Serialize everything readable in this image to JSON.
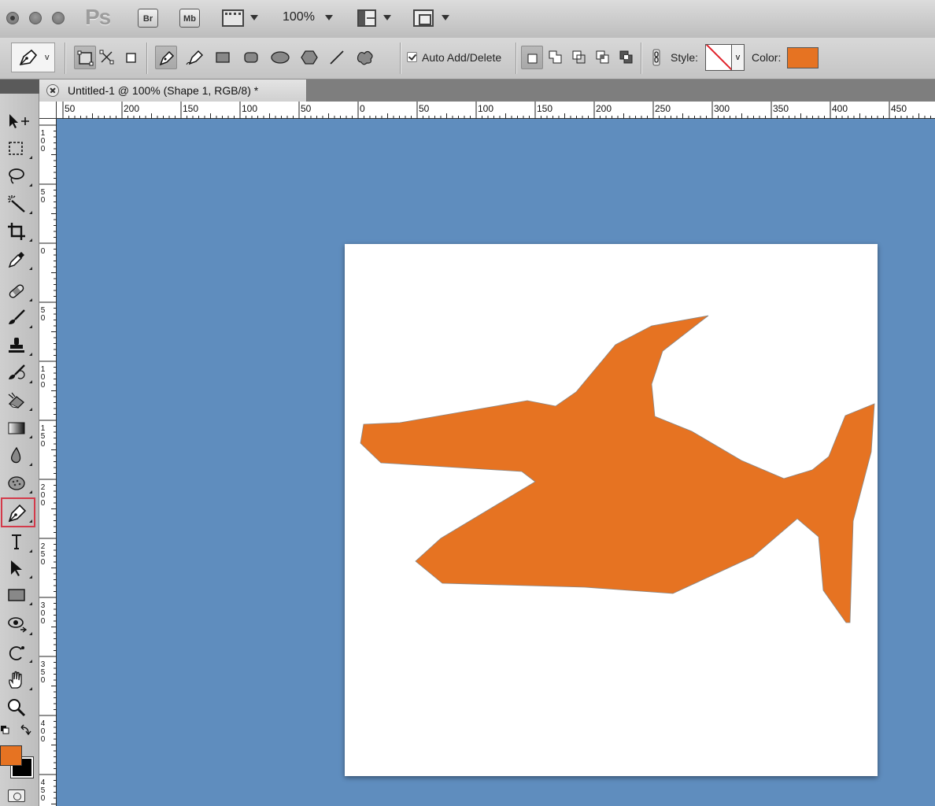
{
  "app": {
    "logo": "Ps",
    "bridge_label": "Br",
    "minibridge_label": "Mb",
    "zoom": "100%"
  },
  "options": {
    "preset_caret": "v",
    "auto_add_delete": "Auto Add/Delete",
    "auto_add_delete_checked": true,
    "style_label": "Style:",
    "style_caret": "v",
    "color_label": "Color:",
    "shape_color": "#e67322"
  },
  "document": {
    "tab_title": "Untitled-1 @ 100% (Shape 1, RGB/8) *"
  },
  "rulers": {
    "horizontal": [
      "50",
      "200",
      "150",
      "100",
      "50",
      "0",
      "50",
      "100",
      "150",
      "200",
      "250",
      "300",
      "350",
      "400",
      "450"
    ],
    "vertical": [
      "100",
      "50",
      "0",
      "50",
      "100",
      "150",
      "200",
      "250",
      "300",
      "350",
      "400",
      "450"
    ]
  },
  "tools": {
    "active": "pen-tool",
    "foreground_color": "#e67322",
    "background_color": "#000000"
  },
  "canvas": {
    "background": "#5f8dbe",
    "document_fill": "#ffffff"
  }
}
